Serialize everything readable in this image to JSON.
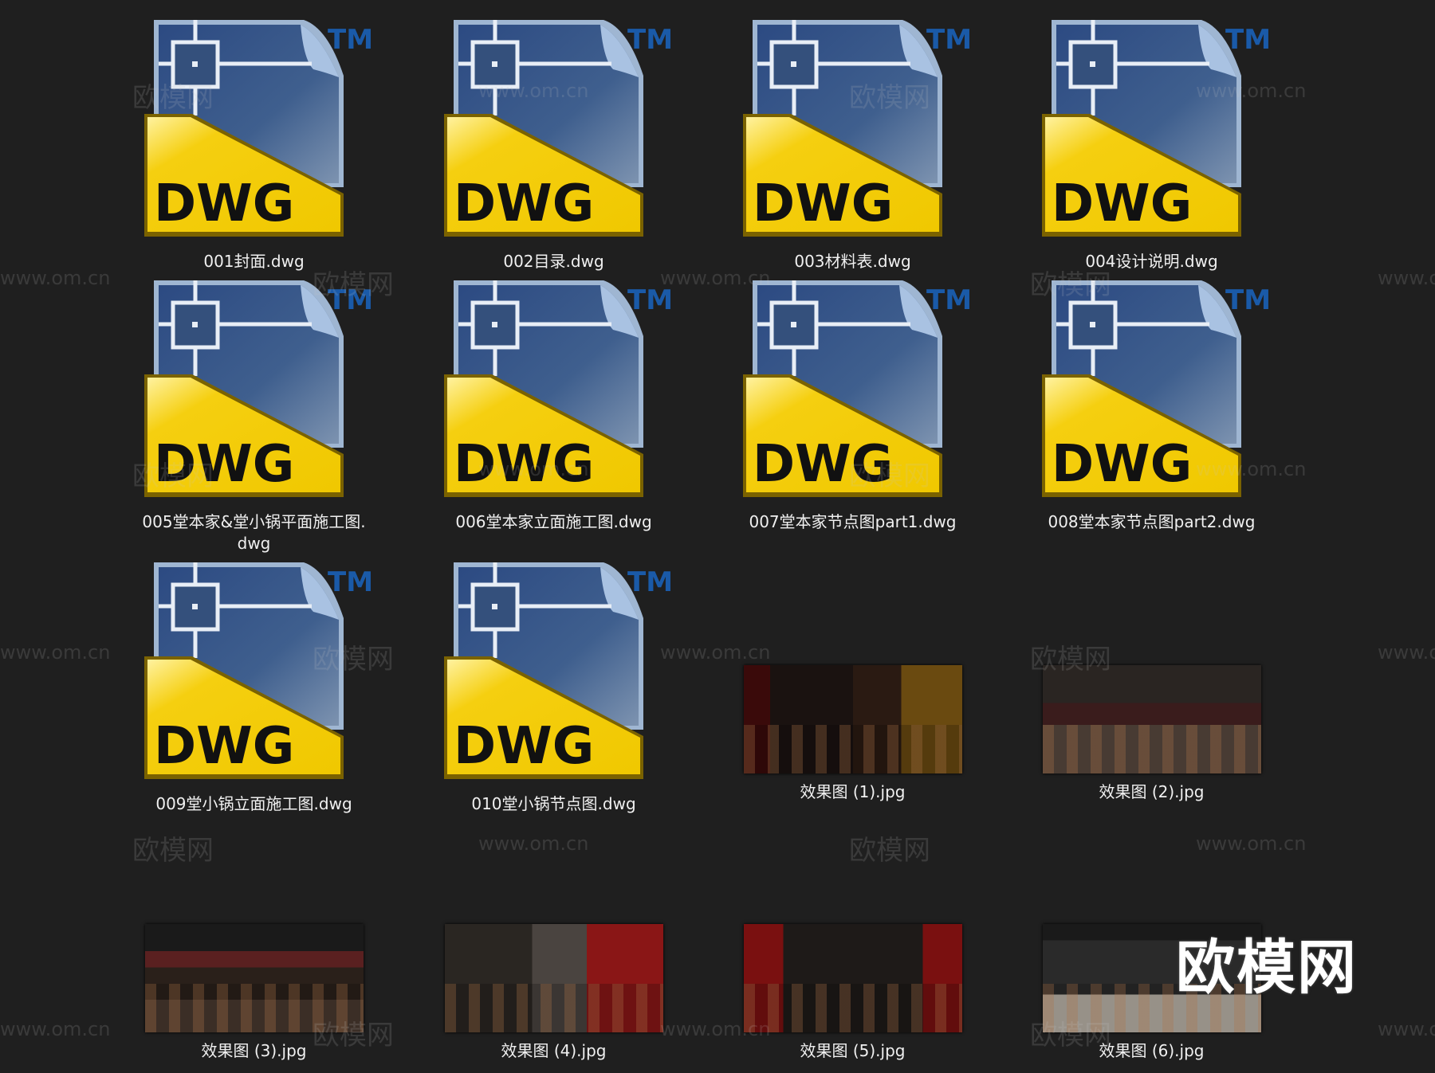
{
  "files": [
    {
      "name": "001封面.dwg",
      "type": "dwg"
    },
    {
      "name": "002目录.dwg",
      "type": "dwg"
    },
    {
      "name": "003材料表.dwg",
      "type": "dwg"
    },
    {
      "name": "004设计说明.dwg",
      "type": "dwg"
    },
    {
      "name": "005堂本家&堂小锅平面施工图.",
      "name2": "dwg",
      "type": "dwg"
    },
    {
      "name": "006堂本家立面施工图.dwg",
      "type": "dwg"
    },
    {
      "name": "007堂本家节点图part1.dwg",
      "type": "dwg"
    },
    {
      "name": "008堂本家节点图part2.dwg",
      "type": "dwg"
    },
    {
      "name": "009堂小锅立面施工图.dwg",
      "type": "dwg"
    },
    {
      "name": "010堂小锅节点图.dwg",
      "type": "dwg"
    },
    {
      "name": "效果图 (1).jpg",
      "type": "jpg"
    },
    {
      "name": "效果图 (2).jpg",
      "type": "jpg"
    },
    {
      "name": "效果图 (3).jpg",
      "type": "jpg"
    },
    {
      "name": "效果图 (4).jpg",
      "type": "jpg"
    },
    {
      "name": "效果图 (5).jpg",
      "type": "jpg"
    },
    {
      "name": "效果图 (6).jpg",
      "type": "jpg"
    }
  ],
  "dwg_icon": {
    "text": "DWG",
    "tm": "TM"
  },
  "watermark": {
    "brand": "欧模网",
    "url": "www.om.cn"
  },
  "colors": {
    "background": "#1f1f1f",
    "dwg_yellow": "#f5cf10",
    "dwg_blue": "#3a5a8c",
    "tm_blue": "#1a5aa8"
  }
}
